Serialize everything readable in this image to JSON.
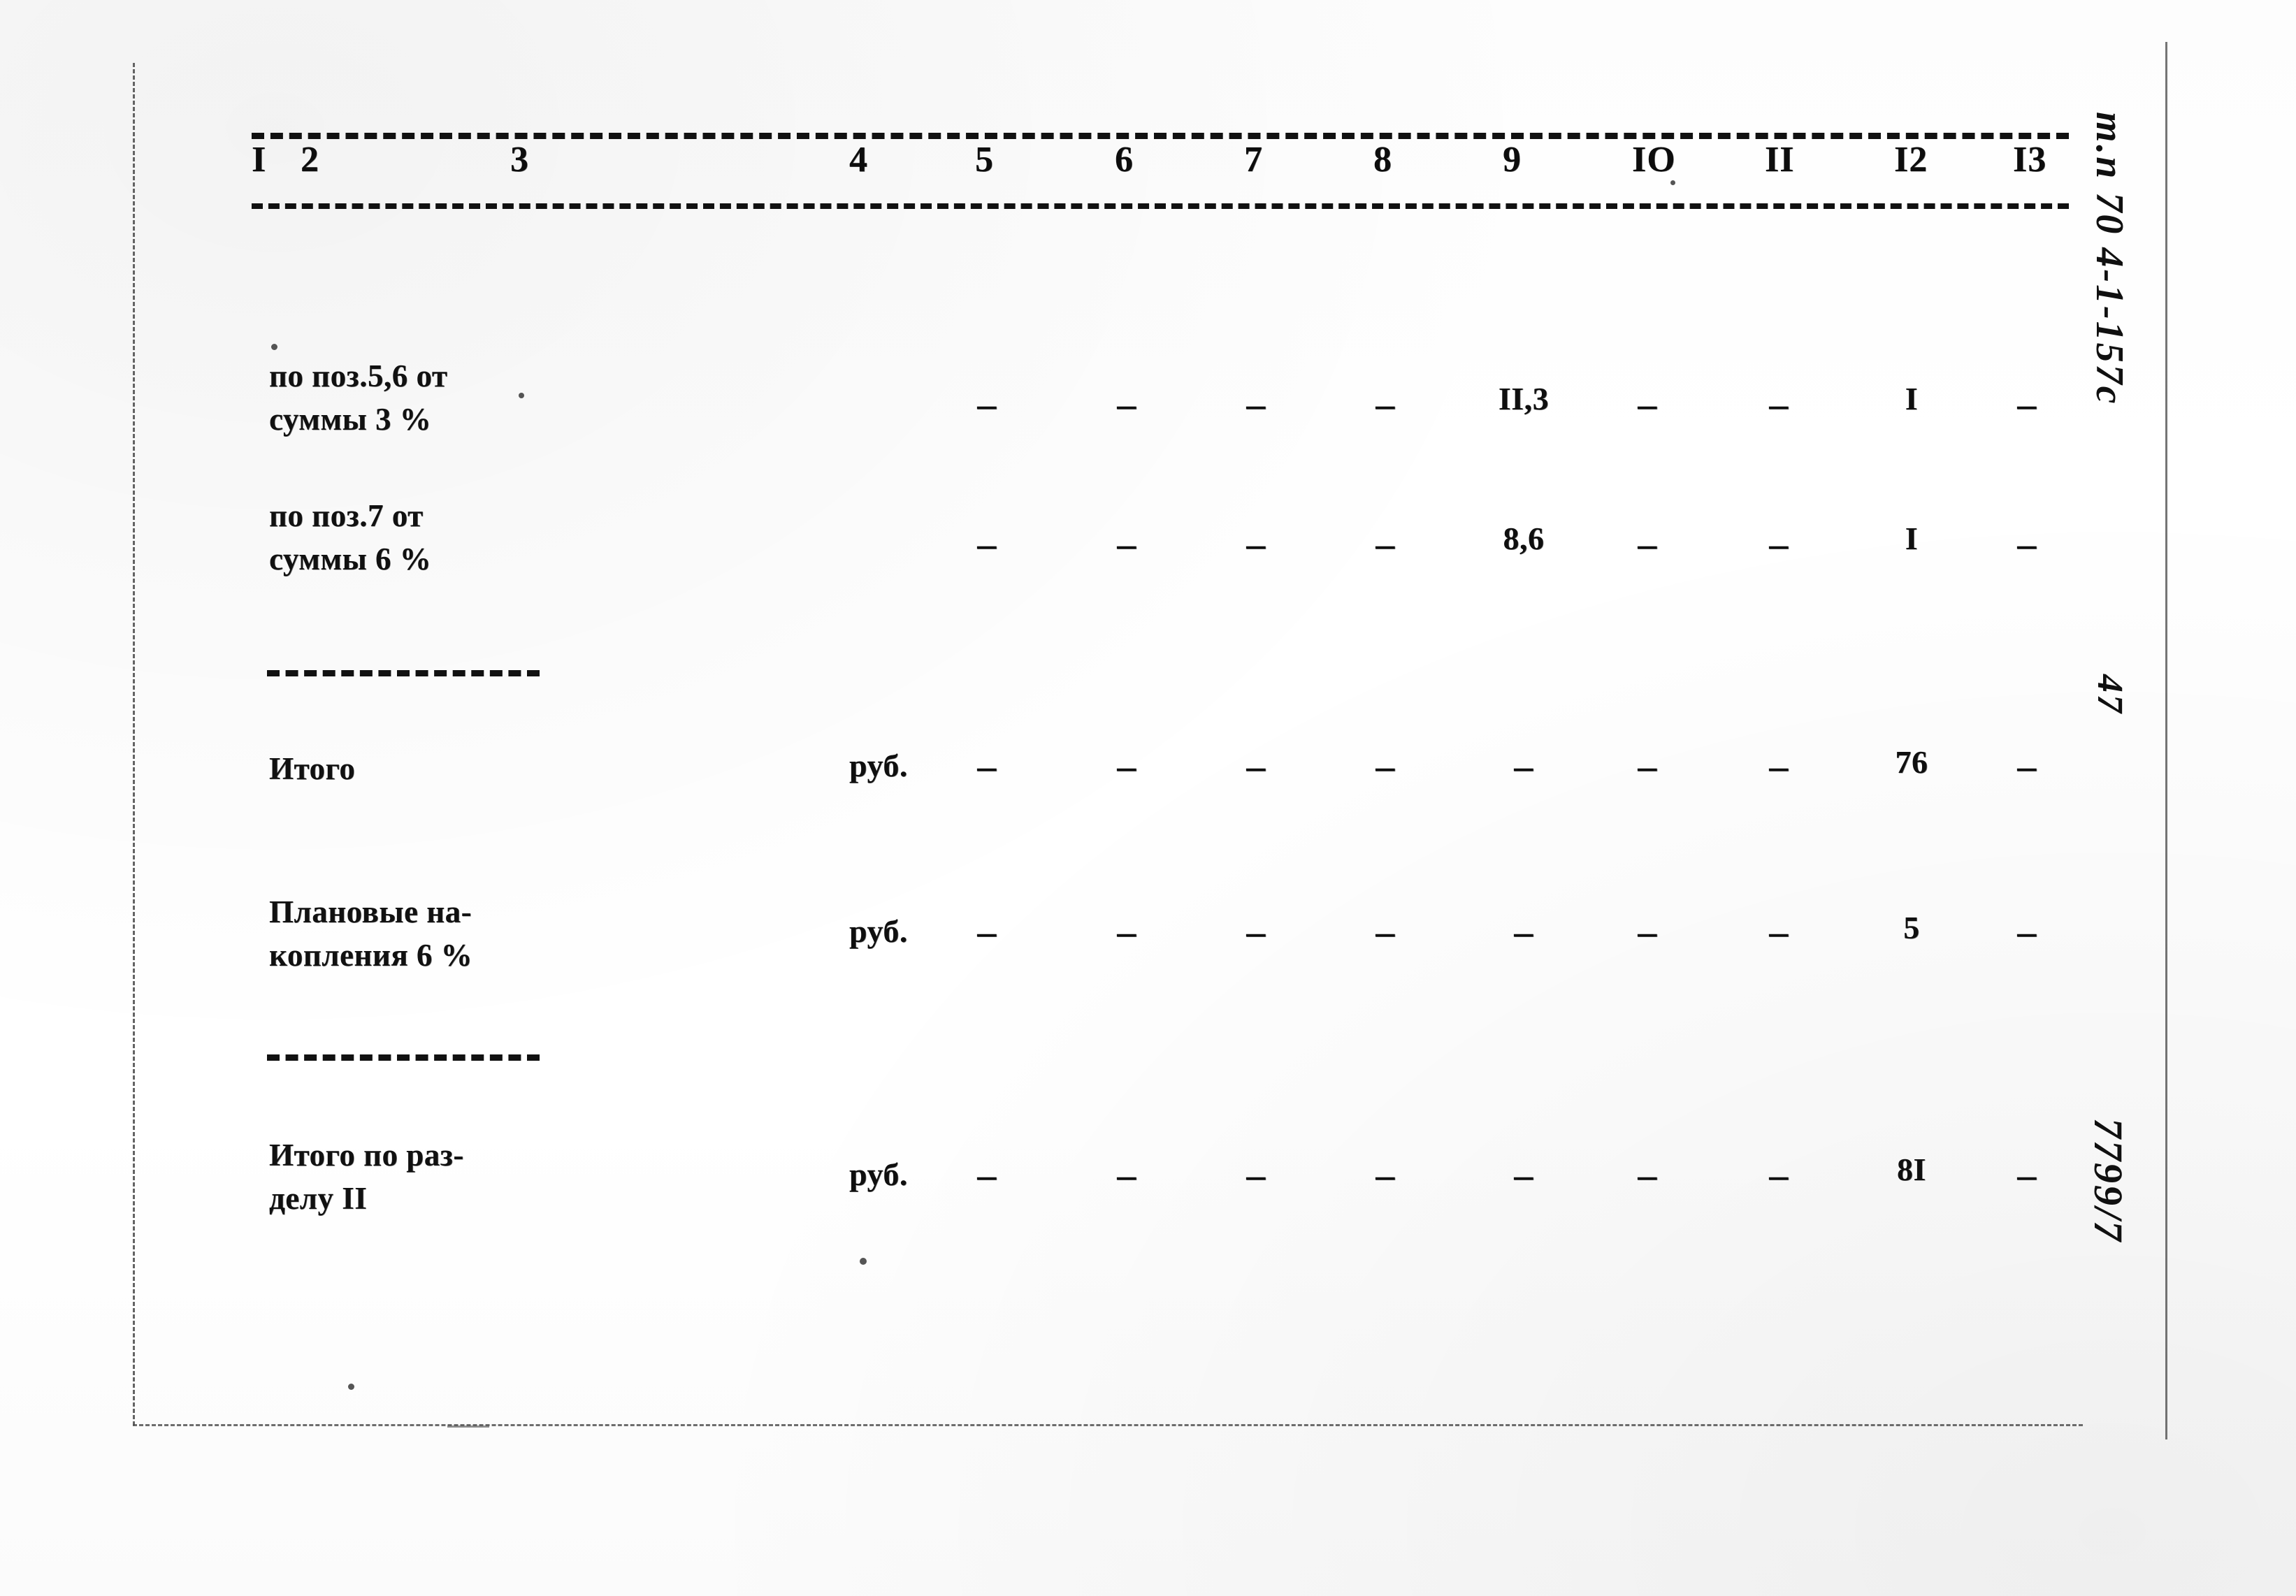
{
  "document": {
    "type": "typewritten-cost-estimate-table",
    "page_number_margin": "47",
    "margin_notes": [
      {
        "name": "spec-code",
        "text": "т.п 70 4-1-157с"
      },
      {
        "name": "page-number",
        "text": "47"
      },
      {
        "name": "archive-number",
        "text": "7799/7"
      }
    ]
  },
  "table": {
    "column_headers": [
      "I",
      "2",
      "3",
      "4",
      "5",
      "6",
      "7",
      "8",
      "9",
      "IO",
      "II",
      "I2",
      "I3"
    ],
    "rows": [
      {
        "name": "row-po-poz-5-6",
        "label": "по поз.5,6 от\nсуммы 3 %",
        "unit": "",
        "cells": [
          "",
          "",
          "",
          "",
          "–",
          "–",
          "–",
          "–",
          "II,3",
          "–",
          "–",
          "I",
          "–"
        ]
      },
      {
        "name": "row-po-poz-7",
        "label": "по поз.7 от\nсуммы 6 %",
        "unit": "",
        "cells": [
          "",
          "",
          "",
          "",
          "–",
          "–",
          "–",
          "–",
          "8,6",
          "–",
          "–",
          "I",
          "–"
        ]
      },
      {
        "name": "row-itogo",
        "label": "Итого",
        "unit": "руб.",
        "cells": [
          "",
          "",
          "",
          "",
          "–",
          "–",
          "–",
          "–",
          "–",
          "–",
          "–",
          "76",
          "–"
        ]
      },
      {
        "name": "row-planovye-nakopleniya",
        "label": "Плановые на-\nкопления 6 %",
        "unit": "руб.",
        "cells": [
          "",
          "",
          "",
          "",
          "–",
          "–",
          "–",
          "–",
          "–",
          "–",
          "–",
          "5",
          "–"
        ]
      },
      {
        "name": "row-itogo-po-razdelu",
        "label": "Итого по раз-\nделу II",
        "unit": "руб.",
        "cells": [
          "",
          "",
          "",
          "",
          "–",
          "–",
          "–",
          "–",
          "–",
          "–",
          "–",
          "8I",
          "–"
        ]
      }
    ]
  },
  "colors": {
    "ink": "#111111",
    "paper": "#ffffff"
  }
}
